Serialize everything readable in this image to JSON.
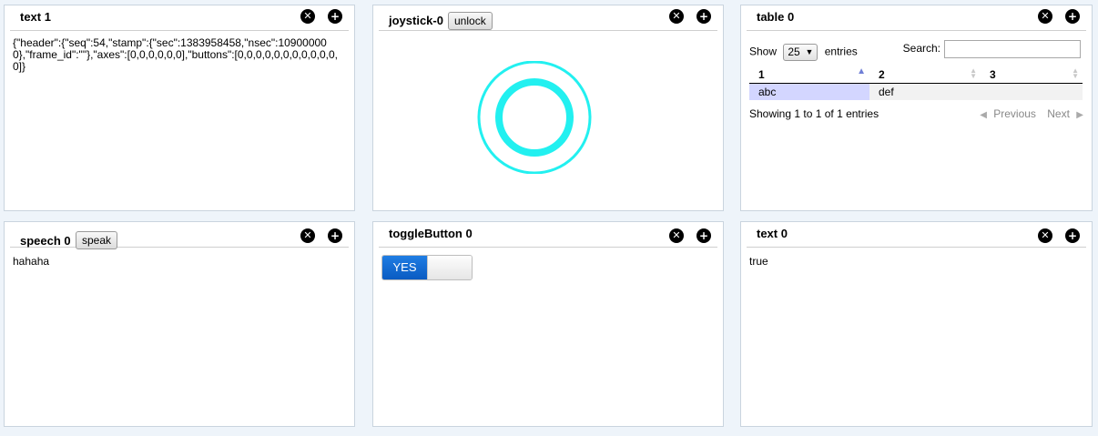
{
  "panels": {
    "text1": {
      "title": "text 1",
      "content": "{\"header\":{\"seq\":54,\"stamp\":{\"sec\":1383958458,\"nsec\":109000000},\"frame_id\":\"\"},\"axes\":[0,0,0,0,0,0],\"buttons\":[0,0,0,0,0,0,0,0,0,0,0,0]}"
    },
    "joystick": {
      "title": "joystick-0",
      "button_label": "unlock",
      "ring_color": "#22f0f0"
    },
    "table": {
      "title": "table 0",
      "show_label": "Show",
      "entries_value": "25",
      "entries_label": "entries",
      "search_label": "Search:",
      "search_value": "",
      "columns": [
        "1",
        "2",
        "3"
      ],
      "rows": [
        [
          "abc",
          "def",
          ""
        ]
      ],
      "info": "Showing 1 to 1 of 1 entries",
      "previous_label": "Previous",
      "next_label": "Next"
    },
    "speech": {
      "title": "speech 0",
      "button_label": "speak",
      "content": "hahaha"
    },
    "toggle": {
      "title": "toggleButton 0",
      "on_label": "YES",
      "state": true
    },
    "text0": {
      "title": "text 0",
      "content": "true"
    }
  },
  "icons": {
    "close": "close-icon",
    "add": "add-icon"
  },
  "colors": {
    "background": "#eef4fa",
    "toggle_on": "#0a5bc2",
    "sorted_cell": "#d3d6ff"
  }
}
